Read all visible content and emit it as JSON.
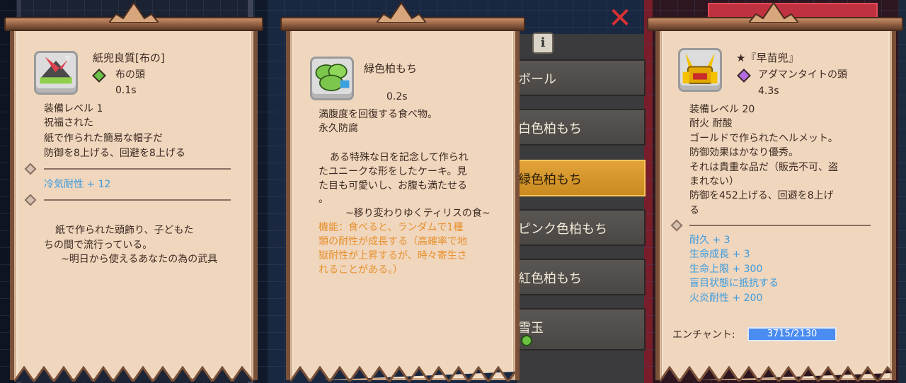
{
  "colors": {
    "parchment": "#efd6bd",
    "frame": "#7a5138",
    "text": "#3c2a22",
    "blue_stat": "#3a9be0",
    "orange_note": "#e8902c",
    "selected": "#e2a43a"
  },
  "card1": {
    "name": "紙兜良質[布の]",
    "slot": "布の頭",
    "weight": "0.1s",
    "lines": [
      "装備レベル 1",
      "祝福された",
      "紙で作られた簡易な帽子だ",
      "防御を8上げる、回避を8上げる"
    ],
    "enchants": [
      "冷気耐性 + 12"
    ],
    "flavor": [
      "紙で作られた頭飾り、子どもた",
      "ちの間で流行っている。",
      "~明日から使えるあなたの為の武具"
    ],
    "icon": "paper-helmet-icon"
  },
  "card2": {
    "name": "緑色柏もち",
    "weight": "0.2s",
    "lines": [
      "満腹度を回復する食べ物。",
      "永久防腐"
    ],
    "desc": [
      "ある特殊な日を記念して作られ",
      "たユニークな形をしたケーキ。見",
      "た目も可愛いし、お腹も満たせる",
      "。"
    ],
    "quote": "~移り変わりゆくティリスの食~",
    "function": [
      "機能：食べると、ランダムで1種",
      "類の耐性が成長する（高確率で地",
      "獄耐性が上昇するが、時々寄生さ",
      "れることがある。）"
    ],
    "icon": "kashiwa-mochi-icon"
  },
  "card3": {
    "name": "★『早苗兜』",
    "slot": "アダマンタイトの頭",
    "weight": "4.3s",
    "lines": [
      "装備レベル 20",
      "耐火 耐酸",
      "ゴールドで作られたヘルメット。",
      "防御効果はかなり優秀。",
      "それは貴重な品だ（販売不可、盗",
      "まれない）",
      "防御を452上げる、回避を8上げ",
      "る"
    ],
    "enchants": [
      "耐久 + 3",
      "生命成長 + 3",
      "生命上限 + 300",
      "盲目状態に抵抗する",
      "火炎耐性 + 200"
    ],
    "enchant_label": "エンチャント:",
    "enchant_value": "3715/2130",
    "enchant_fill": 1.0,
    "icon": "gold-kabuto-icon"
  },
  "list": {
    "items": [
      "ボール",
      "白色柏もち",
      "緑色柏もち",
      "ピンク色柏もち",
      "紅色柏もち",
      "雪玉"
    ],
    "selected_index": 2
  },
  "buttons": {
    "info": "i",
    "close": "✕"
  }
}
